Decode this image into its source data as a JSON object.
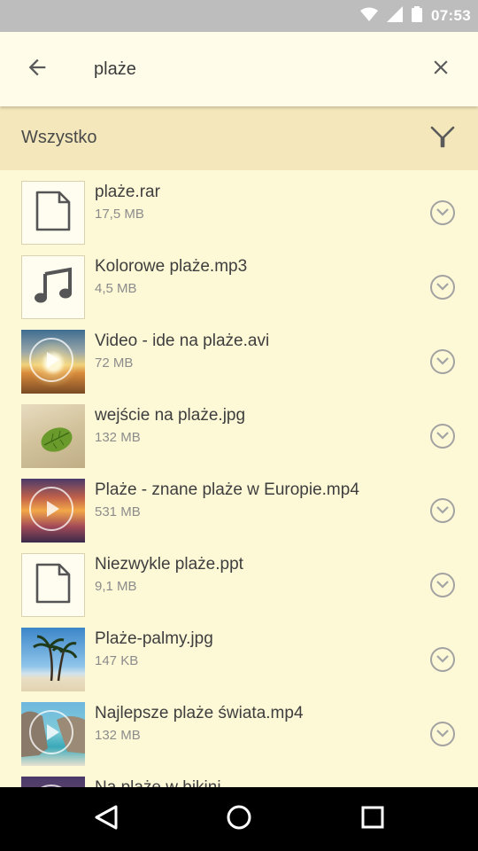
{
  "status_bar": {
    "time": "07:53",
    "icons": [
      "wifi-icon",
      "signal-icon",
      "battery-icon"
    ]
  },
  "search": {
    "query": "plaże",
    "icons": {
      "back": "arrow-left-icon",
      "clear": "close-icon"
    }
  },
  "filter": {
    "label": "Wszystko",
    "icon": "filter-funnel-icon"
  },
  "files": [
    {
      "name": "plaże.rar",
      "size": "17,5 MB",
      "thumb": "document-icon"
    },
    {
      "name": "Kolorowe plaże.mp3",
      "size": "4,5 MB",
      "thumb": "music-note-icon"
    },
    {
      "name": "Video - ide na plaże.avi",
      "size": "72 MB",
      "thumb": "video-sunset-thumbnail"
    },
    {
      "name": "wejście na plaże.jpg",
      "size": "132 MB",
      "thumb": "leaf-on-sand-thumbnail"
    },
    {
      "name": "Plaże - znane plaże w Europie.mp4",
      "size": "531 MB",
      "thumb": "video-sunset-thumbnail"
    },
    {
      "name": "Niezwykle plaże.ppt",
      "size": "9,1 MB",
      "thumb": "document-icon"
    },
    {
      "name": "Plaże-palmy.jpg",
      "size": "147 KB",
      "thumb": "palm-trees-thumbnail"
    },
    {
      "name": "Najlepsze plaże świata.mp4",
      "size": "132 MB",
      "thumb": "video-rock-arch-thumbnail"
    },
    {
      "name": "Na plaże w bikini",
      "size": "",
      "thumb": "video-sunset-thumbnail"
    }
  ],
  "nav": {
    "back": "triangle-back-icon",
    "home": "circle-home-icon",
    "recents": "square-recents-icon"
  },
  "colors": {
    "background": "#fdf8d6",
    "filter_bar": "#f3e7bb",
    "app_bar": "#fffde9",
    "status_bar": "#bdbdbd"
  }
}
